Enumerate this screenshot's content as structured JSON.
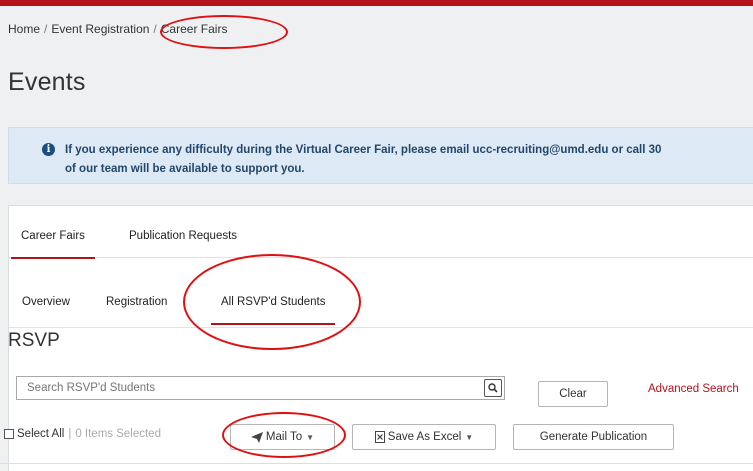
{
  "breadcrumb": {
    "home": "Home",
    "separator": "/",
    "event_registration": "Event Registration",
    "career_fairs": "Career Fairs"
  },
  "page_title": "Events",
  "alert": {
    "line1": "If you experience any difficulty during the Virtual Career Fair, please email ucc-recruiting@umd.edu or call 30",
    "line2": "of our team will be available to support you."
  },
  "tabs_primary": [
    {
      "label": "Career Fairs",
      "active": true
    },
    {
      "label": "Publication Requests",
      "active": false
    }
  ],
  "tabs_secondary": [
    {
      "label": "Overview",
      "active": false
    },
    {
      "label": "Registration",
      "active": false
    },
    {
      "label": "All RSVP'd Students",
      "active": true
    }
  ],
  "section_title": "RSVP",
  "search": {
    "placeholder": "Search RSVP'd Students",
    "clear_label": "Clear",
    "advanced_label": "Advanced Search"
  },
  "actions": {
    "select_all_label": "Select All",
    "separator": "|",
    "selected_count": "0 Items Selected",
    "mail_to_label": "Mail To",
    "save_excel_label": "Save As Excel",
    "generate_label": "Generate Publication"
  },
  "colors": {
    "brand_red": "#b3131b",
    "alert_bg": "#dde9f4",
    "alert_text": "#23476b",
    "annotation": "#e01010"
  }
}
